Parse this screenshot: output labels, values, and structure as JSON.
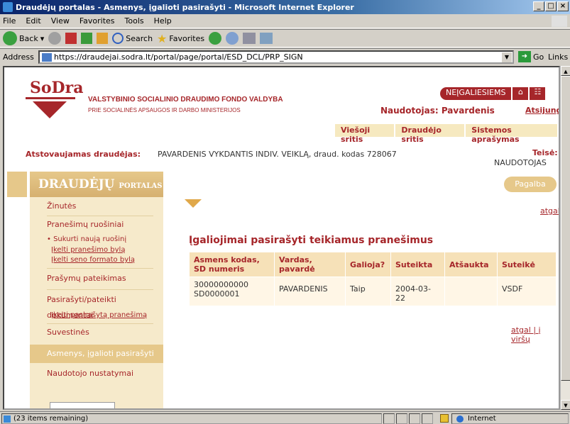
{
  "window": {
    "title": "Draudėjų portalas - Asmenys, įgalioti pasirašyti - Microsoft Internet Explorer",
    "buttons": [
      "_",
      "□",
      "×"
    ]
  },
  "menu": [
    "File",
    "Edit",
    "View",
    "Favorites",
    "Tools",
    "Help"
  ],
  "toolbar": {
    "back": "Back",
    "search": "Search",
    "favorites": "Favorites"
  },
  "address": {
    "label": "Address",
    "url": "https://draudejai.sodra.lt/portal/page/portal/ESD_DCL/PRP_SIGN",
    "go": "Go",
    "links": "Links"
  },
  "status": {
    "text": "(23 items remaining)",
    "zone": "Internet"
  },
  "site": {
    "logo": "SoDra",
    "org_line1": "VALSTYBINIO SOCIALINIO DRAUDIMO FONDO VALDYBA",
    "org_line2": "PRIE SOCIALINĖS APSAUGOS IR DARBO MINISTERIJOS",
    "nav_pill": "NEĮGALIESIEMS",
    "user_label": "Naudotojas: Pavardenis",
    "logout": "Atsijungti",
    "tabs": [
      "Viešoji sritis",
      "Draudėjo sritis",
      "Sistemos aprašymas"
    ],
    "represented_label": "Atstovaujamas draudėjas:",
    "represented_value": "PAVARDENIS  VYKDANTIS INDIV. VEIKLĄ, draud. kodas 728067",
    "role_label": "Teisė:",
    "role_value": "NAUDOTOJAS",
    "help": "Pagalba",
    "back": "atgal",
    "back_top": "atgal | į viršų"
  },
  "sidebar": {
    "title": "DRAUDĖJŲ",
    "title_small": "PORTALAS",
    "items": [
      {
        "label": "Žinutės"
      },
      {
        "label": "Pranešimų ruošiniai"
      },
      {
        "label": "• Sukurti naują ruošinį"
      },
      {
        "label": "Įkelti pranešimo bylą"
      },
      {
        "label": "Įkelti seno formato bylą"
      },
      {
        "label": "Prašymų pateikimas"
      },
      {
        "label": "Pasirašyti/pateikti dokumentai"
      },
      {
        "label": "Įkelti pasirašytą pranešimą"
      },
      {
        "label": "Suvestinės"
      },
      {
        "label": "Asmenys, įgalioti pasirašyti"
      },
      {
        "label": "Naudotojo nustatymai"
      }
    ]
  },
  "content": {
    "title": "Įgaliojimai pasirašyti teikiamus pranešimus",
    "headers": [
      "Asmens kodas, SD numeris",
      "Vardas, pavardė",
      "Galioja?",
      "Suteikta",
      "Atšaukta",
      "Suteikė"
    ],
    "rows": [
      [
        "30000000000",
        "SD0000001",
        "PAVARDENIS",
        "Taip",
        "2004-03-22",
        "",
        "VSDF"
      ]
    ]
  }
}
